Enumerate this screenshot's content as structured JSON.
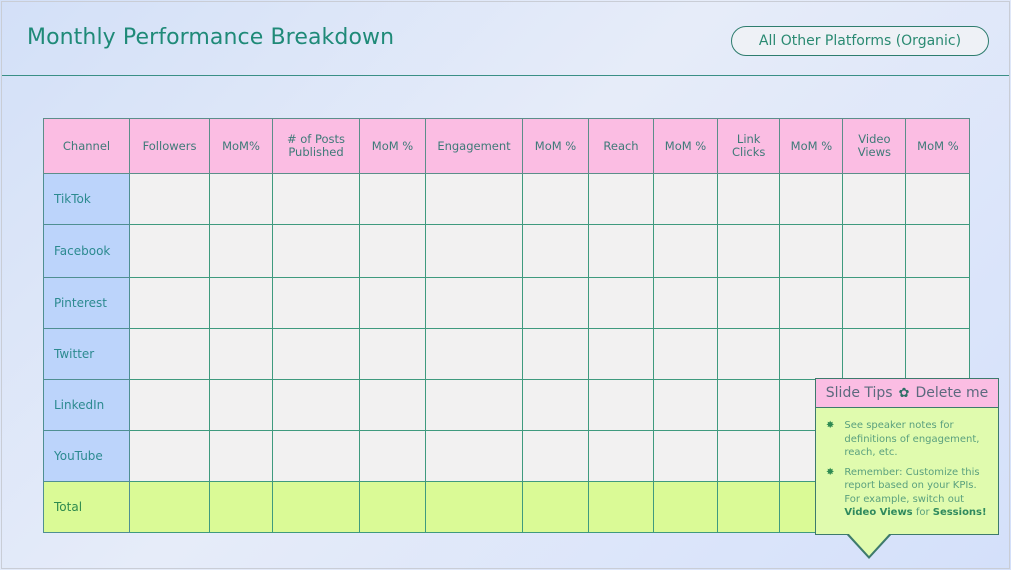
{
  "page": {
    "title": "Monthly Performance Breakdown",
    "platform_pill": "All Other Platforms (Organic)"
  },
  "table": {
    "headers": [
      "Channel",
      "Followers",
      "MoM%",
      "# of Posts Published",
      "MoM %",
      "Engagement",
      "MoM %",
      "Reach",
      "MoM %",
      "Link Clicks",
      "MoM %",
      "Video Views",
      "MoM %"
    ],
    "rows": [
      {
        "channel": "TikTok",
        "values": [
          "",
          "",
          "",
          "",
          "",
          "",
          "",
          "",
          "",
          "",
          "",
          ""
        ]
      },
      {
        "channel": "Facebook",
        "values": [
          "",
          "",
          "",
          "",
          "",
          "",
          "",
          "",
          "",
          "",
          "",
          ""
        ]
      },
      {
        "channel": "Pinterest",
        "values": [
          "",
          "",
          "",
          "",
          "",
          "",
          "",
          "",
          "",
          "",
          "",
          ""
        ]
      },
      {
        "channel": "Twitter",
        "values": [
          "",
          "",
          "",
          "",
          "",
          "",
          "",
          "",
          "",
          "",
          "",
          ""
        ]
      },
      {
        "channel": "LinkedIn",
        "values": [
          "",
          "",
          "",
          "",
          "",
          "",
          "",
          "",
          "",
          "",
          "",
          ""
        ]
      },
      {
        "channel": "YouTube",
        "values": [
          "",
          "",
          "",
          "",
          "",
          "",
          "",
          "",
          "",
          "",
          "",
          ""
        ]
      }
    ],
    "total": {
      "channel": "Total",
      "values": [
        "",
        "",
        "",
        "",
        "",
        "",
        "",
        "",
        "",
        "",
        "",
        ""
      ]
    }
  },
  "tips": {
    "title_left": "Slide Tips",
    "flower_icon": "✿",
    "title_right": "Delete me",
    "bullet_icon": "✸",
    "items": [
      {
        "text": "See speaker notes for definitions of engagement, reach, etc."
      },
      {
        "text_before": "Remember: Customize this report based on your KPIs. For example, switch out ",
        "bold1": "Video Views",
        "middle": " for ",
        "bold2": "Sessions!"
      }
    ]
  },
  "colors": {
    "accent_teal": "#1f8a78",
    "header_pink": "#fbbde3",
    "channel_blue": "#bcd4fb",
    "total_green": "#dafa96",
    "cell_gray": "#f2f1f1"
  }
}
